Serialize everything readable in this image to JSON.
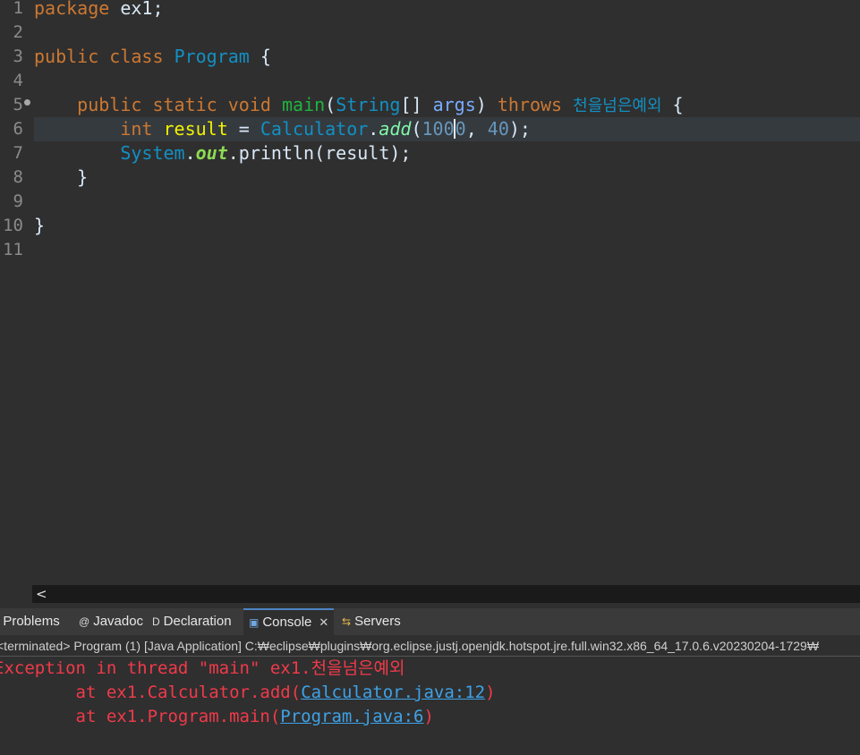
{
  "editor": {
    "line_numbers": [
      "1",
      "2",
      "3",
      "4",
      "5",
      "6",
      "7",
      "8",
      "9",
      "10",
      "11"
    ],
    "lines": {
      "l1": {
        "kw": "package",
        "rest": " ex1;"
      },
      "l3": {
        "kw1": "public",
        "kw2": "class",
        "cls": "Program",
        "rest": " {"
      },
      "l5": {
        "kw1": "public",
        "kw2": "static",
        "kw3": "void",
        "fn": "main",
        "p1": "(",
        "cls": "String",
        "p2": "[] ",
        "param": "args",
        "p3": ") ",
        "kw4": "throws",
        "exc": "천을넘은예외",
        "p4": " {"
      },
      "l6": {
        "kw": "int",
        "var": "result",
        "eq": " = ",
        "cls": "Calculator",
        "dot": ".",
        "fn": "add",
        "p1": "(",
        "n1a": "100",
        "n1b": "0",
        "comma": ", ",
        "n2": "40",
        "p2": ");"
      },
      "l7": {
        "cls": "System",
        "dot1": ".",
        "fld": "out",
        "dot2": ".",
        "fn": "println",
        "rest": "(result);"
      },
      "l8": {
        "rest": "}"
      },
      "l10": {
        "rest": "}"
      }
    }
  },
  "scrollbar": {
    "left_arrow": "<"
  },
  "panel": {
    "tabs": [
      {
        "label": "Problems",
        "icon": "!"
      },
      {
        "label": "Javadoc",
        "icon": "@"
      },
      {
        "label": "Declaration",
        "icon": "D"
      },
      {
        "label": "Console",
        "icon": "▣",
        "close": "✕"
      },
      {
        "label": "Servers",
        "icon": "⇆"
      }
    ],
    "status": "<terminated> Program (1) [Java Application] C:₩eclipse₩plugins₩org.eclipse.justj.openjdk.hotspot.jre.full.win32.x86_64_17.0.6.v20230204-1729₩",
    "output": {
      "line1": "Exception in thread \"main\" ex1.천을넘은예외",
      "line2_prefix": "\tat ex1.Calculator.add(",
      "line2_link": "Calculator.java:12",
      "line2_suffix": ")",
      "line3_prefix": "\tat ex1.Program.main(",
      "line3_link": "Program.java:6",
      "line3_suffix": ")"
    }
  },
  "colors": {
    "background": "#2f2f2f",
    "keyword": "#cc7832",
    "class": "#1290c3",
    "error": "#f03a4a",
    "link": "#3ea2e8"
  }
}
